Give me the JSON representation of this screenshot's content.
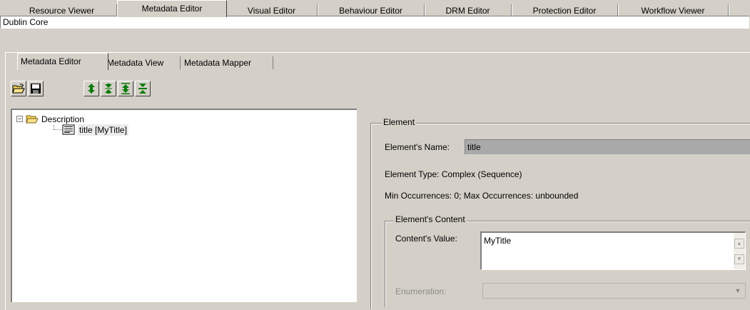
{
  "top_tabs": [
    "Resource Viewer",
    "Metadata Editor",
    "Visual Editor",
    "Behaviour Editor",
    "DRM Editor",
    "Protection Editor",
    "Workflow Viewer"
  ],
  "active_top_tab": "Metadata Editor",
  "document_name": "Dublin Core",
  "sub_tabs": [
    "Metadata Editor",
    "Metadata View",
    "Metadata Mapper"
  ],
  "active_sub_tab": "Metadata Editor",
  "toolbar": {
    "icons": [
      "open-folder-icon",
      "save-disk-icon",
      "move-up-down-icon",
      "collapse-icon",
      "expand-all-icon",
      "collapse-all-icon"
    ]
  },
  "tree": {
    "root_label": "Description",
    "child_label": "title [MyTitle]",
    "expander": "−"
  },
  "element": {
    "group_title": "Element",
    "name_label": "Element's Name:",
    "name_value": "title",
    "type_text": "Element Type: Complex (Sequence)",
    "occurrences_text": "Min Occurrences: 0; Max Occurrences: unbounded"
  },
  "content": {
    "group_title": "Element's Content",
    "value_label": "Content's Value:",
    "value": "MyTitle",
    "enumeration_label": "Enumeration:",
    "enumeration_value": ""
  },
  "colors": {
    "window_bg": "#d4d0c8",
    "disabled_field": "#a9a9a9",
    "icon_green": "#0a7a0a",
    "folder_yellow": "#f2d35a"
  }
}
